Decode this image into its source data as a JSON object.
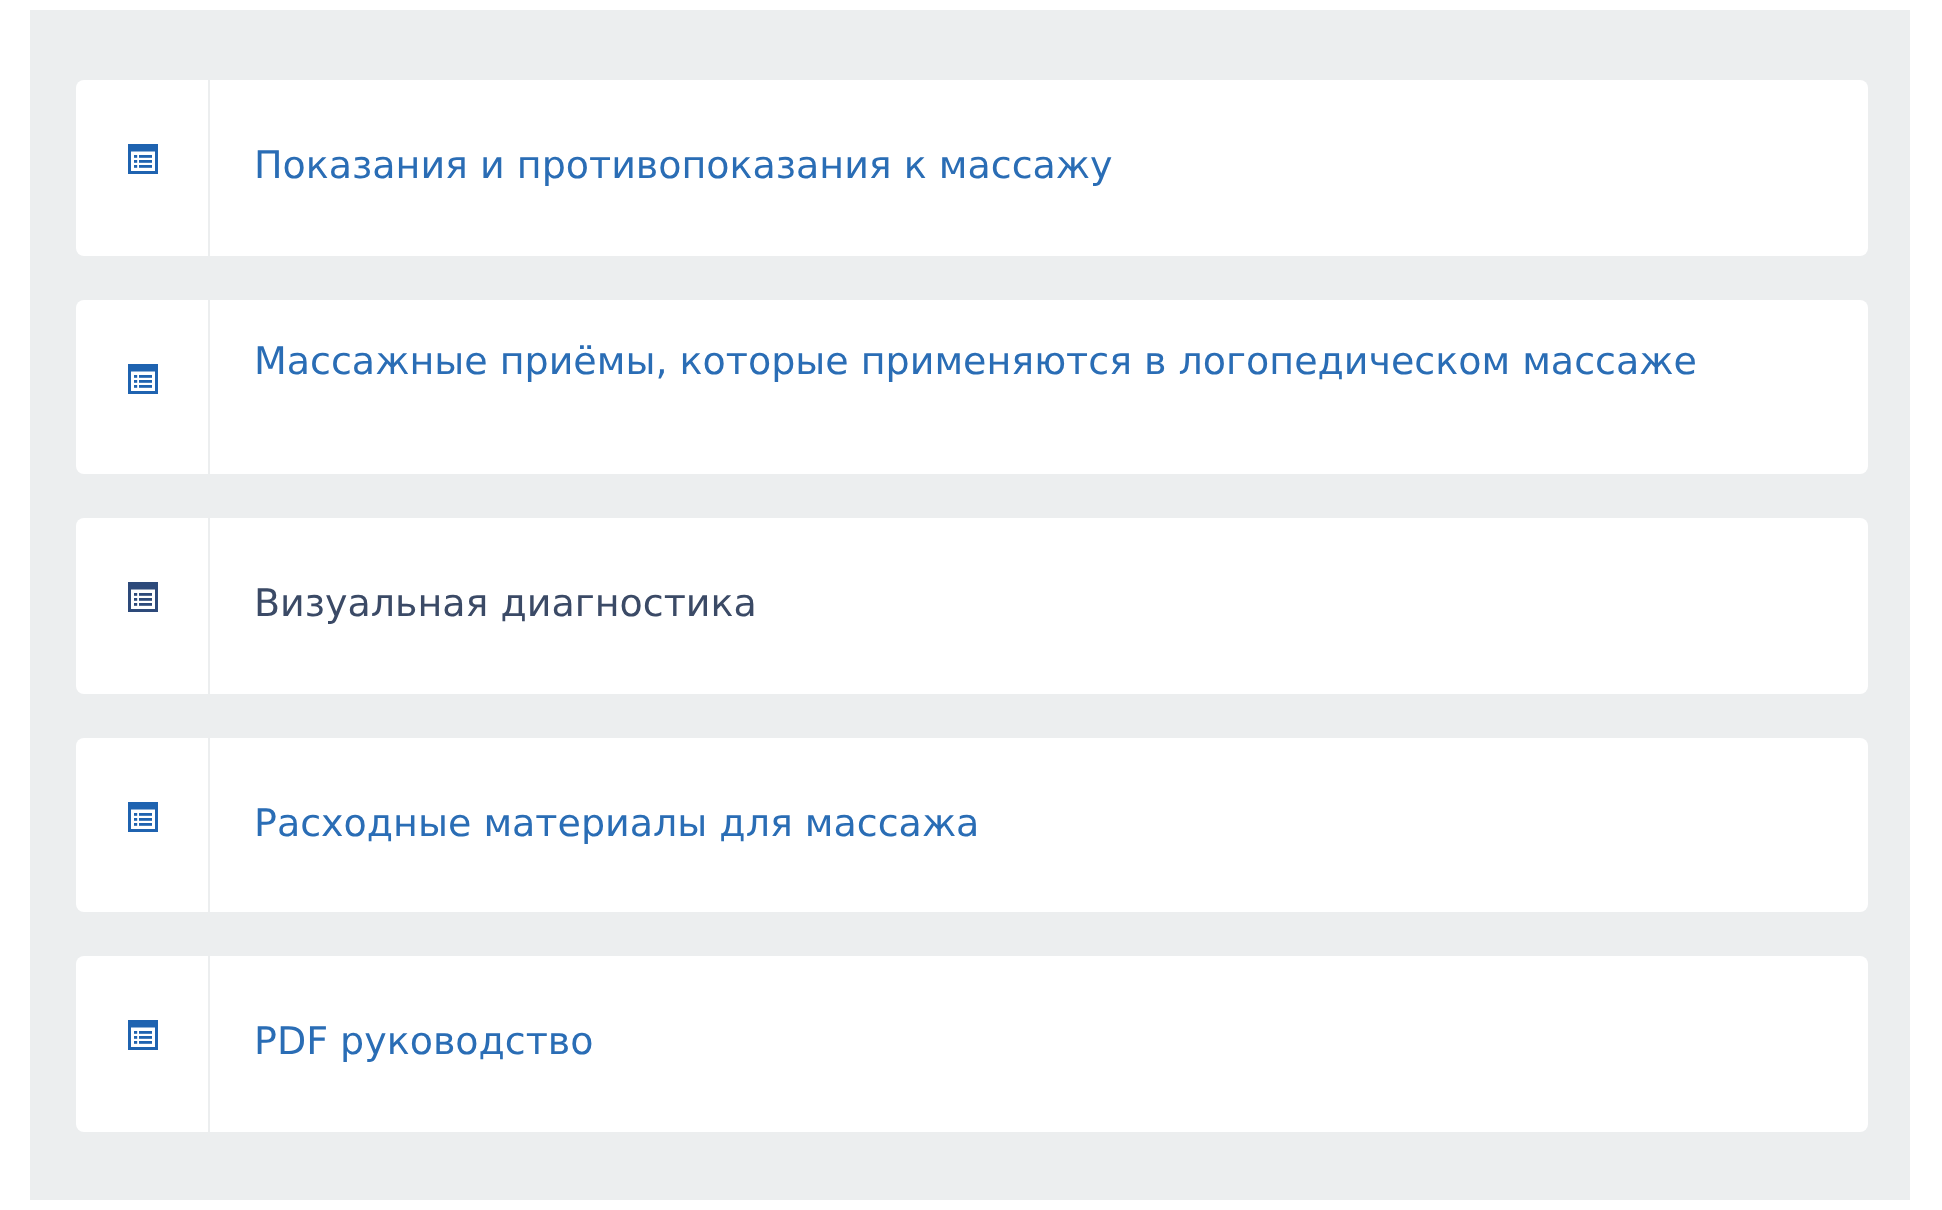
{
  "lessons": [
    {
      "title": "Показания и противопоказания к массажу",
      "visited": false
    },
    {
      "title": "Массажные приёмы, которые применяются в логопедическом массаже",
      "visited": false
    },
    {
      "title": "Визуальная диагностика",
      "visited": true
    },
    {
      "title": "Расходные материалы для массажа",
      "visited": false
    },
    {
      "title": "PDF руководство",
      "visited": false
    }
  ]
}
